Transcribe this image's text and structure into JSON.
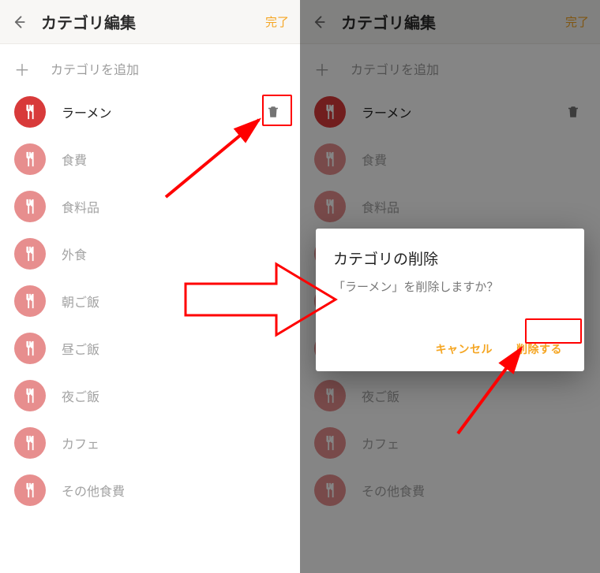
{
  "header": {
    "title": "カテゴリ編集",
    "done": "完了"
  },
  "addRow": {
    "label": "カテゴリを追加"
  },
  "categories": [
    {
      "label": "ラーメン",
      "active": true,
      "trash": true
    },
    {
      "label": "食費"
    },
    {
      "label": "食料品"
    },
    {
      "label": "外食"
    },
    {
      "label": "朝ご飯"
    },
    {
      "label": "昼ご飯"
    },
    {
      "label": "夜ご飯"
    },
    {
      "label": "カフェ"
    },
    {
      "label": "その他食費"
    }
  ],
  "dialog": {
    "title": "カテゴリの削除",
    "message": "「ラーメン」を削除しますか？",
    "cancel": "キャンセル",
    "confirm": "削除する"
  }
}
